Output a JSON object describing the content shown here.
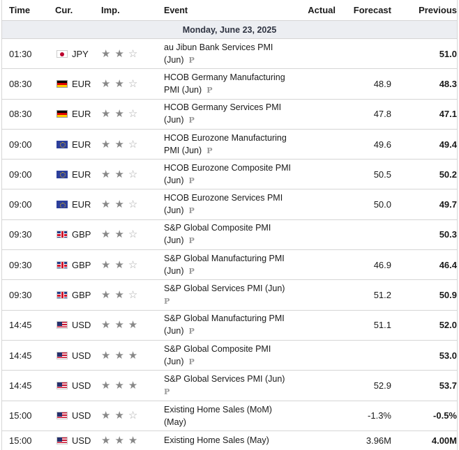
{
  "header": {
    "time": "Time",
    "currency": "Cur.",
    "importance": "Imp.",
    "event": "Event",
    "actual": "Actual",
    "forecast": "Forecast",
    "previous": "Previous"
  },
  "date_label": "Monday, June 23, 2025",
  "preliminary_mark": "P",
  "rows": [
    {
      "time": "01:30",
      "flag": "jpy",
      "currency": "JPY",
      "stars": 2,
      "event_line1": "au Jibun Bank Services PMI",
      "event_line2": "(Jun)",
      "actual": "",
      "forecast": "",
      "previous": "51.0"
    },
    {
      "time": "08:30",
      "flag": "eur-de",
      "currency": "EUR",
      "stars": 2,
      "event_line1": "HCOB Germany Manufacturing",
      "event_line2": "PMI (Jun)",
      "actual": "",
      "forecast": "48.9",
      "previous": "48.3"
    },
    {
      "time": "08:30",
      "flag": "eur-de",
      "currency": "EUR",
      "stars": 2,
      "event_line1": "HCOB Germany Services PMI",
      "event_line2": "(Jun)",
      "actual": "",
      "forecast": "47.8",
      "previous": "47.1"
    },
    {
      "time": "09:00",
      "flag": "eur-eu",
      "currency": "EUR",
      "stars": 2,
      "event_line1": "HCOB Eurozone Manufacturing",
      "event_line2": "PMI (Jun)",
      "actual": "",
      "forecast": "49.6",
      "previous": "49.4"
    },
    {
      "time": "09:00",
      "flag": "eur-eu",
      "currency": "EUR",
      "stars": 2,
      "event_line1": "HCOB Eurozone Composite PMI",
      "event_line2": "(Jun)",
      "actual": "",
      "forecast": "50.5",
      "previous": "50.2"
    },
    {
      "time": "09:00",
      "flag": "eur-eu",
      "currency": "EUR",
      "stars": 2,
      "event_line1": "HCOB Eurozone Services PMI",
      "event_line2": "(Jun)",
      "actual": "",
      "forecast": "50.0",
      "previous": "49.7"
    },
    {
      "time": "09:30",
      "flag": "gbp",
      "currency": "GBP",
      "stars": 2,
      "event_line1": "S&P Global Composite PMI",
      "event_line2": "(Jun)",
      "actual": "",
      "forecast": "",
      "previous": "50.3"
    },
    {
      "time": "09:30",
      "flag": "gbp",
      "currency": "GBP",
      "stars": 2,
      "event_line1": "S&P Global Manufacturing PMI",
      "event_line2": "(Jun)",
      "actual": "",
      "forecast": "46.9",
      "previous": "46.4"
    },
    {
      "time": "09:30",
      "flag": "gbp",
      "currency": "GBP",
      "stars": 2,
      "event_line1": "S&P Global Services PMI (Jun)",
      "event_line2": "",
      "actual": "",
      "forecast": "51.2",
      "previous": "50.9"
    },
    {
      "time": "14:45",
      "flag": "usd",
      "currency": "USD",
      "stars": 3,
      "event_line1": "S&P Global Manufacturing PMI",
      "event_line2": "(Jun)",
      "actual": "",
      "forecast": "51.1",
      "previous": "52.0"
    },
    {
      "time": "14:45",
      "flag": "usd",
      "currency": "USD",
      "stars": 3,
      "event_line1": "S&P Global Composite PMI",
      "event_line2": "(Jun)",
      "actual": "",
      "forecast": "",
      "previous": "53.0"
    },
    {
      "time": "14:45",
      "flag": "usd",
      "currency": "USD",
      "stars": 3,
      "event_line1": "S&P Global Services PMI (Jun)",
      "event_line2": "",
      "actual": "",
      "forecast": "52.9",
      "previous": "53.7"
    },
    {
      "time": "15:00",
      "flag": "usd",
      "currency": "USD",
      "stars": 2,
      "event_line1": "Existing Home Sales (MoM)",
      "event_line2": "(May)",
      "actual": "",
      "forecast": "-1.3%",
      "previous": "-0.5%",
      "no_mark": true
    },
    {
      "time": "15:00",
      "flag": "usd",
      "currency": "USD",
      "stars": 3,
      "event_line1": "Existing Home Sales (May)",
      "event_line2": "",
      "actual": "",
      "forecast": "3.96M",
      "previous": "4.00M",
      "no_mark": true,
      "single_line": true
    }
  ],
  "icons": {
    "star_filled": "star-filled-icon",
    "star_empty": "star-empty-icon",
    "preliminary": "preliminary-p-icon"
  }
}
